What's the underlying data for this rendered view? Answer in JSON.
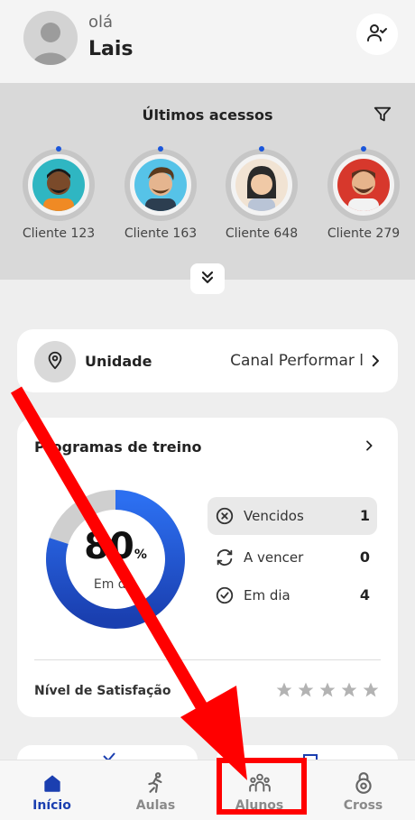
{
  "header": {
    "greeting": "olá",
    "user_name": "Lais"
  },
  "recent": {
    "title": "Últimos acessos",
    "clients": [
      {
        "label": "Cliente 123",
        "skin": "#7a4a2a",
        "bg": "#2fb6c2",
        "hair": "#1a1a1a"
      },
      {
        "label": "Cliente 163",
        "skin": "#e5b58f",
        "bg": "#56c3e8",
        "hair": "#5a3a1e"
      },
      {
        "label": "Cliente 648",
        "skin": "#f0c9a6",
        "bg": "#f1e3d3",
        "hair": "#2a2a2a"
      },
      {
        "label": "Cliente 279",
        "skin": "#e6b48c",
        "bg": "#d7382c",
        "hair": "#5a3320"
      }
    ]
  },
  "unit": {
    "label": "Unidade",
    "value": "Canal Performar l"
  },
  "programs": {
    "title": "Programas de treino",
    "percent": "80",
    "percent_symbol": "%",
    "percent_caption": "Em dia",
    "stats": [
      {
        "label": "Vencidos",
        "value": "1",
        "icon": "x-circle-icon"
      },
      {
        "label": "A vencer",
        "value": "0",
        "icon": "refresh-icon"
      },
      {
        "label": "Em dia",
        "value": "4",
        "icon": "check-circle-icon"
      }
    ],
    "satisfaction_label": "Nível de Satisfação",
    "satisfaction_stars": 0,
    "satisfaction_max": 5
  },
  "nav": {
    "items": [
      {
        "label": "Início",
        "icon": "home-icon",
        "active": true
      },
      {
        "label": "Aulas",
        "icon": "runner-icon",
        "active": false
      },
      {
        "label": "Alunos",
        "icon": "students-icon",
        "active": false
      },
      {
        "label": "Cross",
        "icon": "kettlebell-icon",
        "active": false
      }
    ]
  },
  "colors": {
    "accent": "#1b3fb0",
    "donut_dark": "#1a3fb0",
    "donut_light": "#2c6ff0",
    "donut_track": "#cfcfcf",
    "annotation": "#ff0000"
  }
}
